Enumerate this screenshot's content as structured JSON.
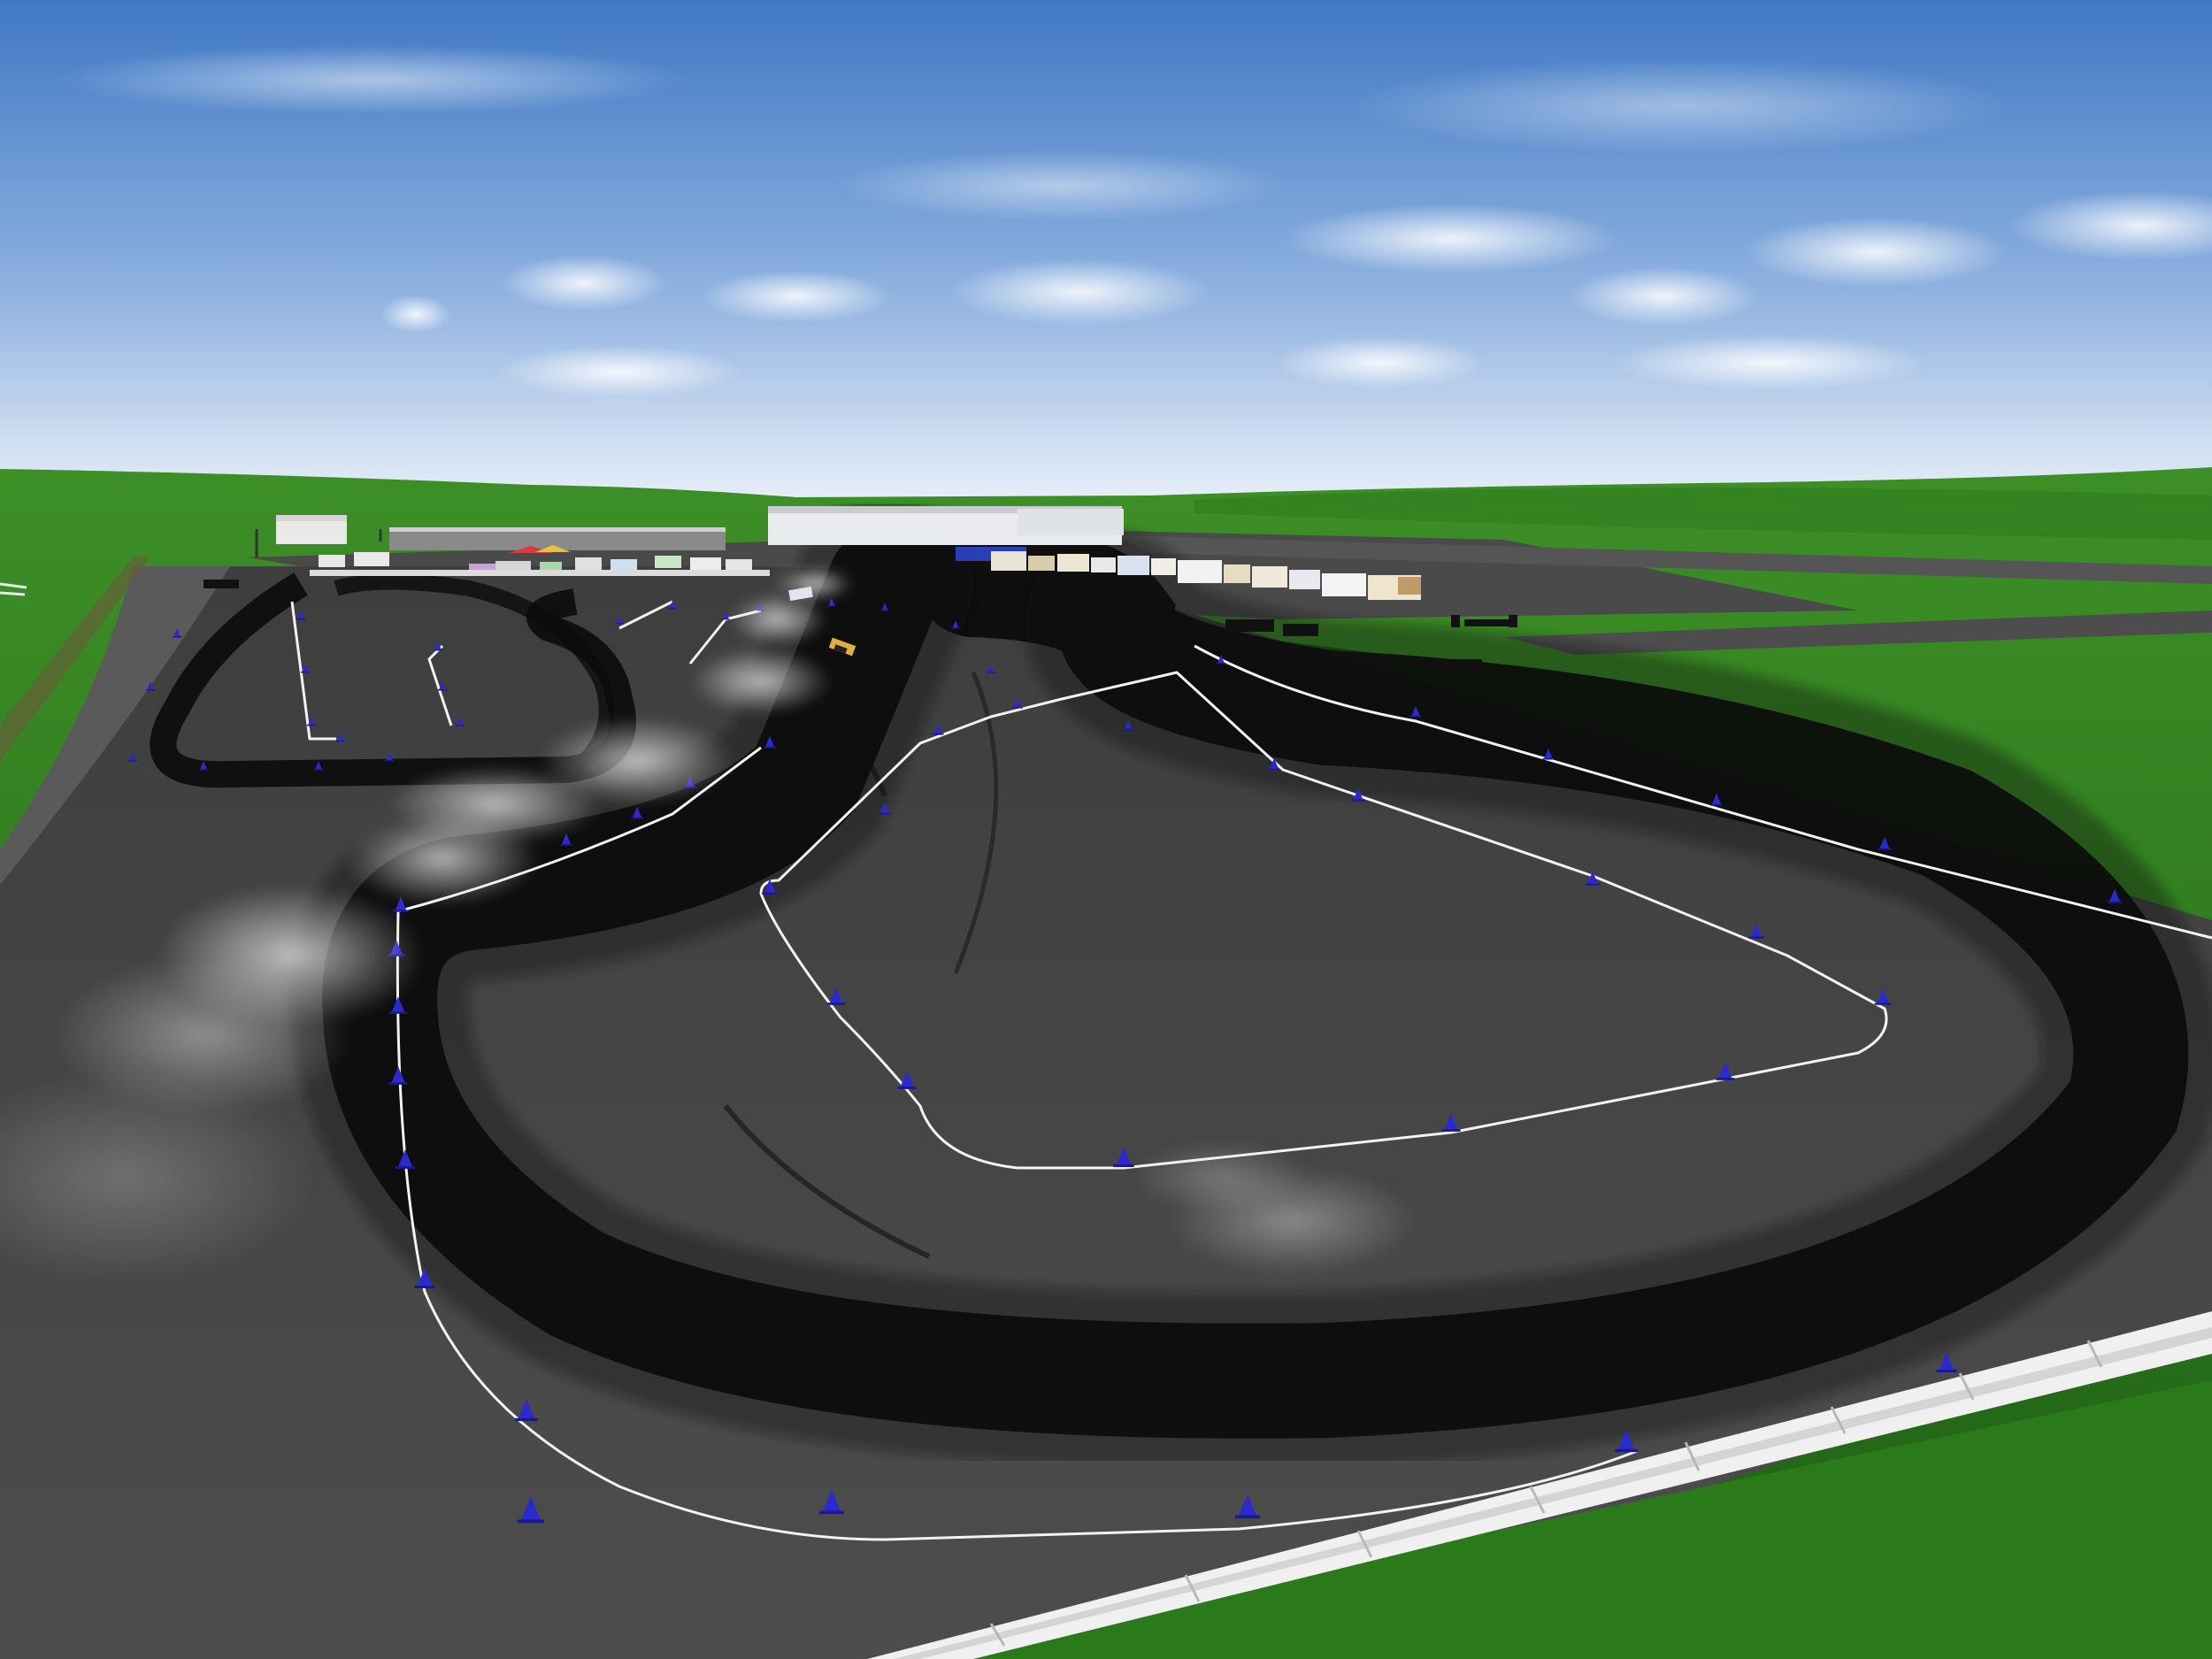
{
  "scene": {
    "type": "3d-render",
    "subject": "drift-track-overview",
    "colors": {
      "sky_top": "#3f78c4",
      "sky_mid": "#8fb2e0",
      "sky_horizon": "#f4f7fb",
      "grass_light": "#3d8f27",
      "grass_dark": "#1f6015",
      "asphalt": "#494949",
      "asphalt_dark": "#353535",
      "rubber": "#0b0b0b",
      "cone": "#2a2ad0",
      "line": "#f2f2f2",
      "barrier": "#f0f0f0",
      "smoke": "#d8d8d8"
    }
  }
}
